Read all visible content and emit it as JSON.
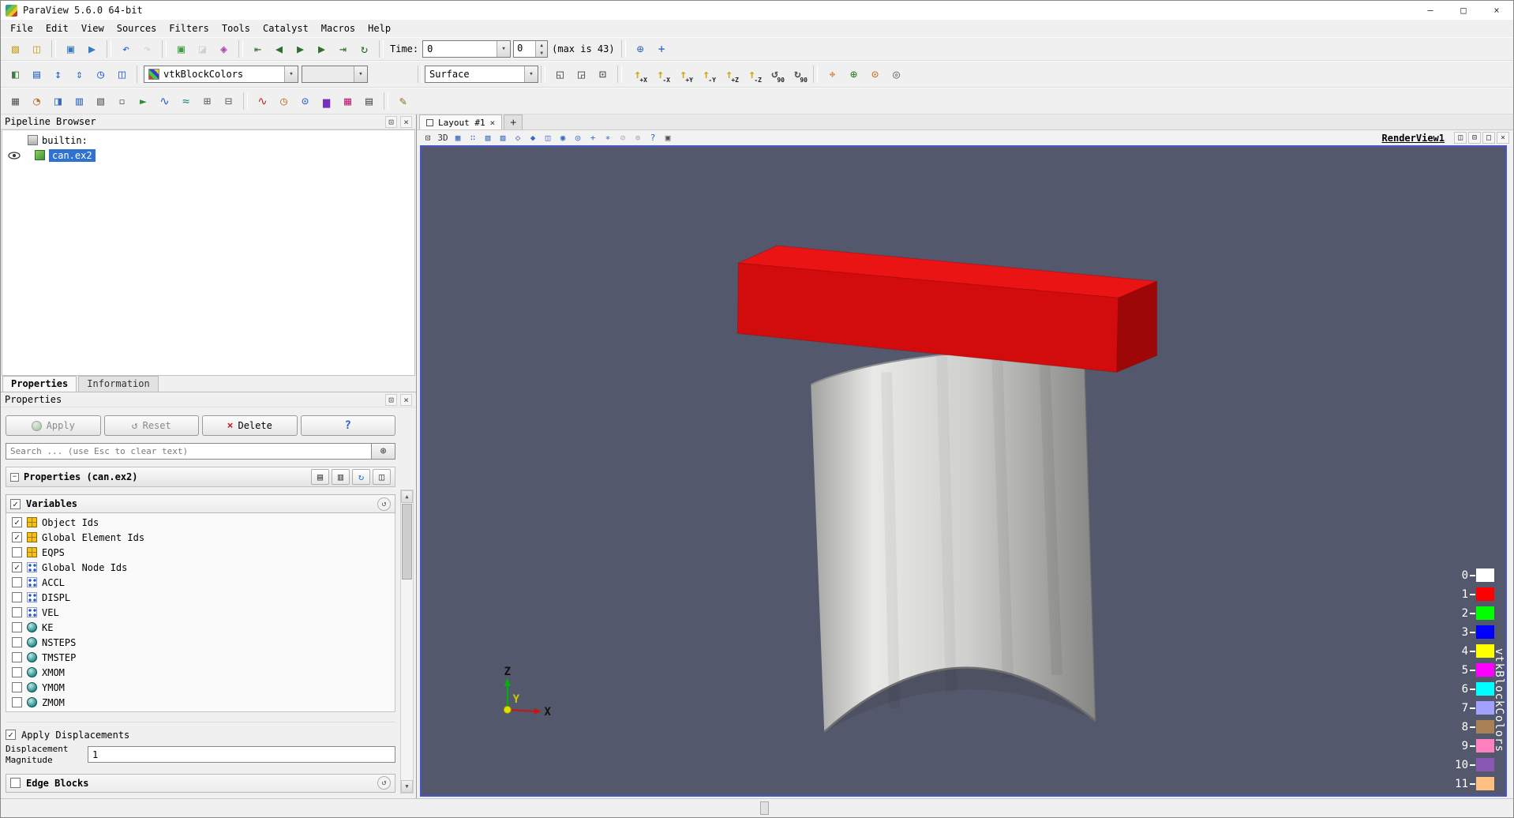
{
  "window": {
    "title": "ParaView 5.6.0 64-bit",
    "minimize": "—",
    "maximize": "□",
    "close": "×"
  },
  "menu": {
    "items": [
      "File",
      "Edit",
      "View",
      "Sources",
      "Filters",
      "Tools",
      "Catalyst",
      "Macros",
      "Help"
    ]
  },
  "colors": {
    "selection": "#2e72d2",
    "focus_border": "#4656c8"
  },
  "dock": {
    "float": "⊡",
    "close": "×"
  },
  "tb1": {
    "g1": [
      {
        "n": "open-file-icon",
        "g": "▨",
        "c": "#c9a227"
      },
      {
        "n": "save-data-icon",
        "g": "◫",
        "c": "#c9a227"
      }
    ],
    "g2": [
      {
        "n": "save-screenshot-icon",
        "g": "▣",
        "c": "#3a7abf"
      },
      {
        "n": "save-animation-icon",
        "g": "▶",
        "c": "#3a7abf"
      }
    ],
    "g3": [
      {
        "n": "undo-icon",
        "g": "↶",
        "c": "#2a5fcf"
      },
      {
        "n": "redo-icon",
        "g": "↷",
        "c": "#9a9a9a",
        "d": 1
      }
    ],
    "g4": [
      {
        "n": "auto-apply-icon",
        "g": "▣",
        "c": "#3f9f3f"
      },
      {
        "n": "source-time-icon",
        "g": "◪",
        "c": "#9a9a9a",
        "d": 1
      },
      {
        "n": "load-color-palette-icon",
        "g": "◈",
        "c": "#b03fb0"
      }
    ],
    "g5": [
      {
        "n": "first-frame-button",
        "g": "⇤",
        "c": "#2f6f2f"
      },
      {
        "n": "previous-frame-button",
        "g": "◀",
        "c": "#2f6f2f"
      },
      {
        "n": "play-button",
        "g": "▶",
        "c": "#2f6f2f"
      },
      {
        "n": "next-frame-button",
        "g": "▶",
        "c": "#2f6f2f"
      },
      {
        "n": "last-frame-button",
        "g": "⇥",
        "c": "#2f6f2f"
      },
      {
        "n": "loop-button",
        "g": "↻",
        "c": "#2f6f2f"
      }
    ],
    "time_label": "Time:",
    "time_value": "0",
    "frame_value": "0",
    "max_label": "(max is 43)",
    "g6": [
      {
        "n": "magnify-icon",
        "g": "⊕",
        "c": "#3a6abf"
      },
      {
        "n": "add-camera-link-icon",
        "g": "+",
        "c": "#2a5fcf"
      }
    ]
  },
  "tb2": {
    "g1": [
      {
        "n": "edit-color-map-icon",
        "g": "◧",
        "c": "#3f7f3f"
      },
      {
        "n": "show-color-legend-icon",
        "g": "▤",
        "c": "#3a6abf"
      },
      {
        "n": "rescale-to-data-range-icon",
        "g": "↕",
        "c": "#2a5fcf"
      },
      {
        "n": "rescale-custom-range-icon",
        "g": "⇕",
        "c": "#2a5fcf"
      },
      {
        "n": "rescale-temporal-range-icon",
        "g": "◷",
        "c": "#2a5fcf"
      },
      {
        "n": "rescale-visible-range-icon",
        "g": "◫",
        "c": "#2a5fcf"
      }
    ],
    "coloring_value": "vtkBlockColors",
    "component_value": "",
    "representation_value": "Surface",
    "g2": [
      {
        "n": "reset-camera-icon",
        "g": "◱",
        "c": "#444444"
      },
      {
        "n": "zoom-to-data-icon",
        "g": "◲",
        "c": "#444444"
      },
      {
        "n": "zoom-to-box-icon",
        "g": "⊡",
        "c": "#444444"
      }
    ],
    "cam_buttons": [
      {
        "l": "+X",
        "g": "↑",
        "a": 1
      },
      {
        "l": "-X",
        "g": "↑",
        "a": 1
      },
      {
        "l": "+Y",
        "g": "↑",
        "a": 1
      },
      {
        "l": "-Y",
        "g": "↑",
        "a": 1
      },
      {
        "l": "+Z",
        "g": "↑",
        "a": 1
      },
      {
        "l": "-Z",
        "g": "↑",
        "a": 1
      },
      {
        "l": "90",
        "g": "↺"
      },
      {
        "l": "90",
        "g": "↻"
      }
    ],
    "g3": [
      {
        "n": "show-orientation-axes-icon",
        "g": "⌖",
        "c": "#cc6a1f"
      },
      {
        "n": "show-center-axes-icon",
        "g": "⊕",
        "c": "#2a7a2a"
      },
      {
        "n": "pick-center-icon",
        "g": "⊙",
        "c": "#cc6a1f"
      },
      {
        "n": "reset-center-icon",
        "g": "◎",
        "c": "#666666"
      }
    ]
  },
  "tb3": {
    "g1": [
      {
        "n": "calculator-filter-icon",
        "g": "▦",
        "c": "#666666"
      },
      {
        "n": "contour-filter-icon",
        "g": "◔",
        "c": "#b8763a"
      },
      {
        "n": "clip-filter-icon",
        "g": "◨",
        "c": "#3a6abf"
      },
      {
        "n": "slice-filter-icon",
        "g": "▥",
        "c": "#3a6abf"
      },
      {
        "n": "threshold-filter-icon",
        "g": "▧",
        "c": "#666666"
      },
      {
        "n": "extract-subset-filter-icon",
        "g": "▫",
        "c": "#666666"
      },
      {
        "n": "glyph-filter-icon",
        "g": "►",
        "c": "#2e8b2e"
      },
      {
        "n": "stream-tracer-filter-icon",
        "g": "∿",
        "c": "#2a5fcf"
      },
      {
        "n": "warp-vector-filter-icon",
        "g": "≈",
        "c": "#2e8b8b"
      },
      {
        "n": "group-datasets-filter-icon",
        "g": "⊞",
        "c": "#666666"
      },
      {
        "n": "extract-block-filter-icon",
        "g": "⊟",
        "c": "#666666"
      }
    ],
    "g2": [
      {
        "n": "plot-over-line-icon",
        "g": "∿",
        "c": "#bf2e2e"
      },
      {
        "n": "plot-selection-over-time-icon",
        "g": "◷",
        "c": "#bf7a2e"
      },
      {
        "n": "probe-location-icon",
        "g": "⊙",
        "c": "#2a5fcf"
      },
      {
        "n": "histogram-icon",
        "g": "▅",
        "c": "#7a2ebf"
      },
      {
        "n": "plot-matrix-icon",
        "g": "▦",
        "c": "#bf2e7a"
      },
      {
        "n": "extract-selection-icon",
        "g": "▤",
        "c": "#555555"
      }
    ],
    "g3": [
      {
        "n": "edit-macro-icon",
        "g": "✎",
        "c": "#8a6a1f"
      }
    ]
  },
  "vt": {
    "g1": [
      {
        "n": "adjust-camera-icon",
        "g": "⊡"
      },
      {
        "n": "interaction-mode-3d",
        "g": "3D"
      },
      {
        "n": "select-cells-on-icon",
        "g": "▦",
        "c": "#3a6abf"
      },
      {
        "n": "select-points-on-icon",
        "g": "∷",
        "c": "#3a6abf"
      },
      {
        "n": "select-cells-rect-icon",
        "g": "▧",
        "c": "#3a6abf"
      },
      {
        "n": "select-points-rect-icon",
        "g": "▨",
        "c": "#3a6abf"
      },
      {
        "n": "select-cells-polygon-icon",
        "g": "◇",
        "c": "#3a6abf"
      },
      {
        "n": "select-points-polygon-icon",
        "g": "◆",
        "c": "#3a6abf"
      },
      {
        "n": "select-block-icon",
        "g": "◫",
        "c": "#3a6abf"
      },
      {
        "n": "interactive-select-cells-icon",
        "g": "◉",
        "c": "#3a6abf"
      },
      {
        "n": "interactive-select-points-icon",
        "g": "◎",
        "c": "#3a6abf"
      },
      {
        "n": "hover-cells-icon",
        "g": "+",
        "c": "#3a6abf"
      },
      {
        "n": "hover-points-icon",
        "g": "∗",
        "c": "#3a6abf"
      },
      {
        "n": "clear-selection-icon",
        "g": "⊘",
        "d": 1
      },
      {
        "n": "zoom-to-selection-icon",
        "g": "⊕",
        "d": 1
      },
      {
        "n": "camera-help-icon",
        "g": "?",
        "c": "#2a5fcf"
      },
      {
        "n": "copy-screenshot-icon",
        "g": "▣",
        "c": "#555555"
      }
    ],
    "title": "RenderView1",
    "btns": [
      {
        "n": "split-horizontal-icon",
        "g": "◫"
      },
      {
        "n": "split-vertical-icon",
        "g": "⊟"
      },
      {
        "n": "maximize-view-icon",
        "g": "□"
      },
      {
        "n": "close-view-icon",
        "g": "×"
      }
    ]
  },
  "layout_tab": {
    "label": "Layout #1",
    "close": "×",
    "add": "+"
  },
  "pipeline": {
    "title": "Pipeline Browser",
    "items": [
      {
        "label": "builtin:"
      },
      {
        "label": "can.ex2"
      }
    ]
  },
  "panel_tabs": {
    "properties": "Properties",
    "information": "Information"
  },
  "props": {
    "dock_title": "Properties",
    "apply": "Apply",
    "reset": "Reset",
    "delete": "Delete",
    "help": "?",
    "search_placeholder": "Search ... (use Esc to clear text)",
    "section_title": "Properties (can.ex2)",
    "variables": {
      "label": "Variables",
      "checked": true
    },
    "variable_list": [
      {
        "name": "Object Ids",
        "checked": true,
        "type": "cell"
      },
      {
        "name": "Global Element Ids",
        "checked": true,
        "type": "cell"
      },
      {
        "name": "EQPS",
        "checked": false,
        "type": "cell"
      },
      {
        "name": "Global Node Ids",
        "checked": true,
        "type": "point"
      },
      {
        "name": "ACCL",
        "checked": false,
        "type": "point"
      },
      {
        "name": "DISPL",
        "checked": false,
        "type": "point"
      },
      {
        "name": "VEL",
        "checked": false,
        "type": "point"
      },
      {
        "name": "KE",
        "checked": false,
        "type": "global"
      },
      {
        "name": "NSTEPS",
        "checked": false,
        "type": "global"
      },
      {
        "name": "TMSTEP",
        "checked": false,
        "type": "global"
      },
      {
        "name": "XMOM",
        "checked": false,
        "type": "global"
      },
      {
        "name": "YMOM",
        "checked": false,
        "type": "global"
      },
      {
        "name": "ZMOM",
        "checked": false,
        "type": "global"
      }
    ],
    "apply_displacements": {
      "label": "Apply Displacements",
      "checked": true
    },
    "magnitude": {
      "label": "Displacement Magnitude",
      "value": "1"
    },
    "edge_blocks": {
      "label": "Edge Blocks",
      "checked": false
    }
  },
  "viewport": {
    "axes": {
      "x": "X",
      "y": "Y",
      "z": "Z"
    },
    "legend": {
      "title": "vtkBlockColors",
      "entries": [
        {
          "label": "0",
          "color": "#ffffff"
        },
        {
          "label": "1",
          "color": "#ff0000"
        },
        {
          "label": "2",
          "color": "#00ff00"
        },
        {
          "label": "3",
          "color": "#0000ff"
        },
        {
          "label": "4",
          "color": "#ffff00"
        },
        {
          "label": "5",
          "color": "#ff00ff"
        },
        {
          "label": "6",
          "color": "#00ffff"
        },
        {
          "label": "7",
          "color": "#a1a1ff"
        },
        {
          "label": "8",
          "color": "#aa8055"
        },
        {
          "label": "9",
          "color": "#ff80bf"
        },
        {
          "label": "10",
          "color": "#8759b3"
        },
        {
          "label": "11",
          "color": "#ffbf80"
        }
      ]
    },
    "scene": {
      "background": "#53586c",
      "lid_top": "#ea1414",
      "lid_front": "#d20c0c",
      "lid_side": "#9e0707",
      "can_gradient": [
        "#a2a2a0",
        "#e9e9e7",
        "#cfcfcd",
        "#868684"
      ],
      "can_edge": "#6e6e6e"
    }
  }
}
